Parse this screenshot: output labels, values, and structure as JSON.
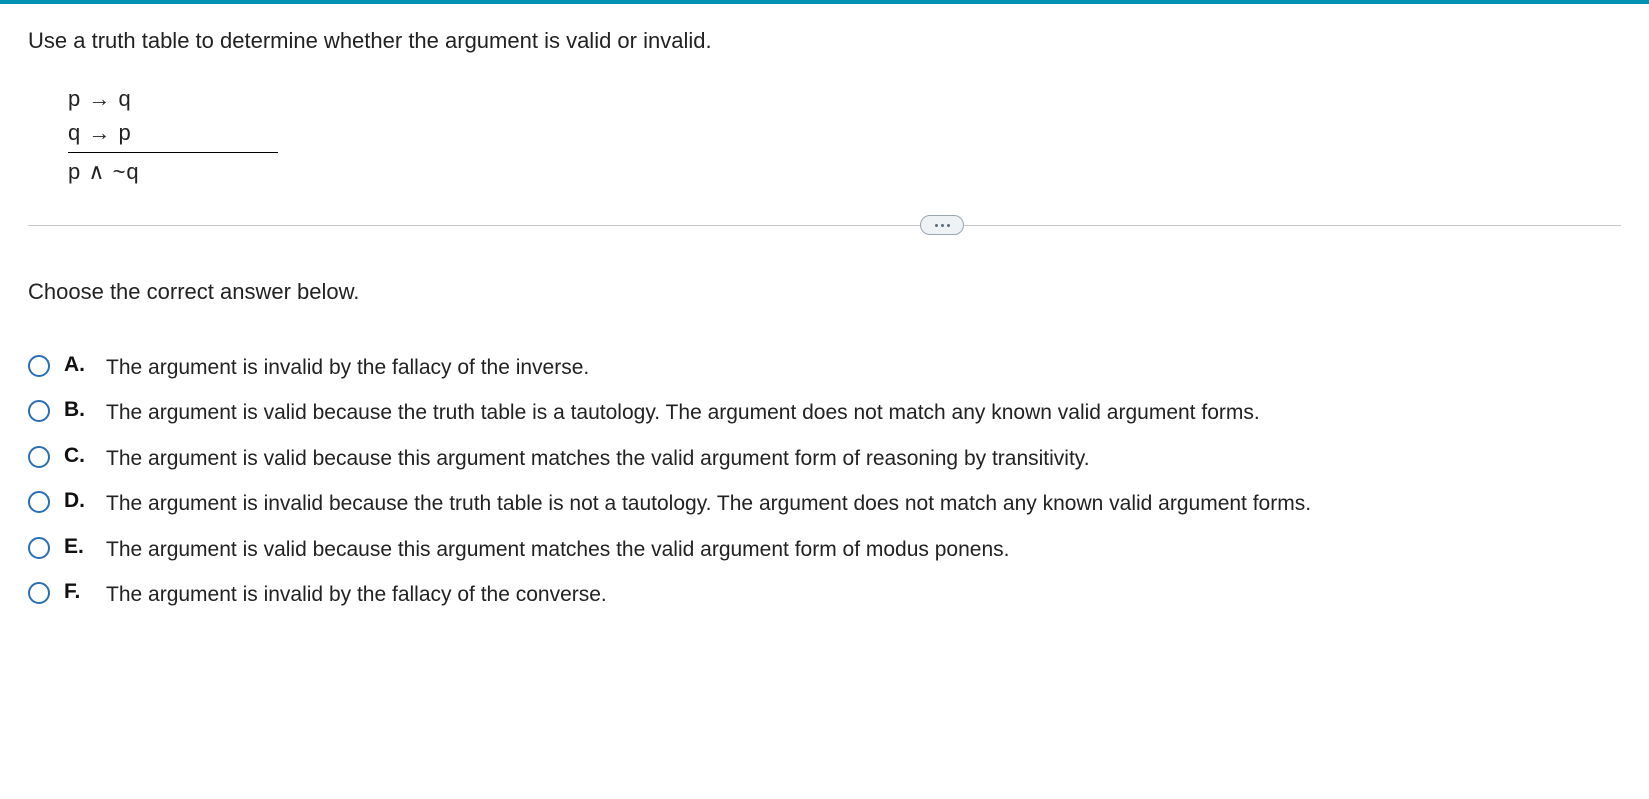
{
  "question": "Use a truth table to determine whether the argument is valid or invalid.",
  "argument": {
    "premise1": "p → q",
    "premise2": "q → p",
    "conclusion": "p ∧ ~q"
  },
  "instruction": "Choose the correct answer below.",
  "choices": [
    {
      "letter": "A.",
      "text": "The argument is invalid by the fallacy of the inverse."
    },
    {
      "letter": "B.",
      "text": "The argument is valid because the truth table is a tautology. The argument does not match any known valid argument forms."
    },
    {
      "letter": "C.",
      "text": "The argument is valid because this argument matches the valid argument form of reasoning by transitivity."
    },
    {
      "letter": "D.",
      "text": "The argument is invalid because the truth table is not a tautology. The argument does not match any known valid argument forms."
    },
    {
      "letter": "E.",
      "text": "The argument is valid because this argument matches the valid argument form of modus ponens."
    },
    {
      "letter": "F.",
      "text": "The argument is invalid by the fallacy of the converse."
    }
  ]
}
